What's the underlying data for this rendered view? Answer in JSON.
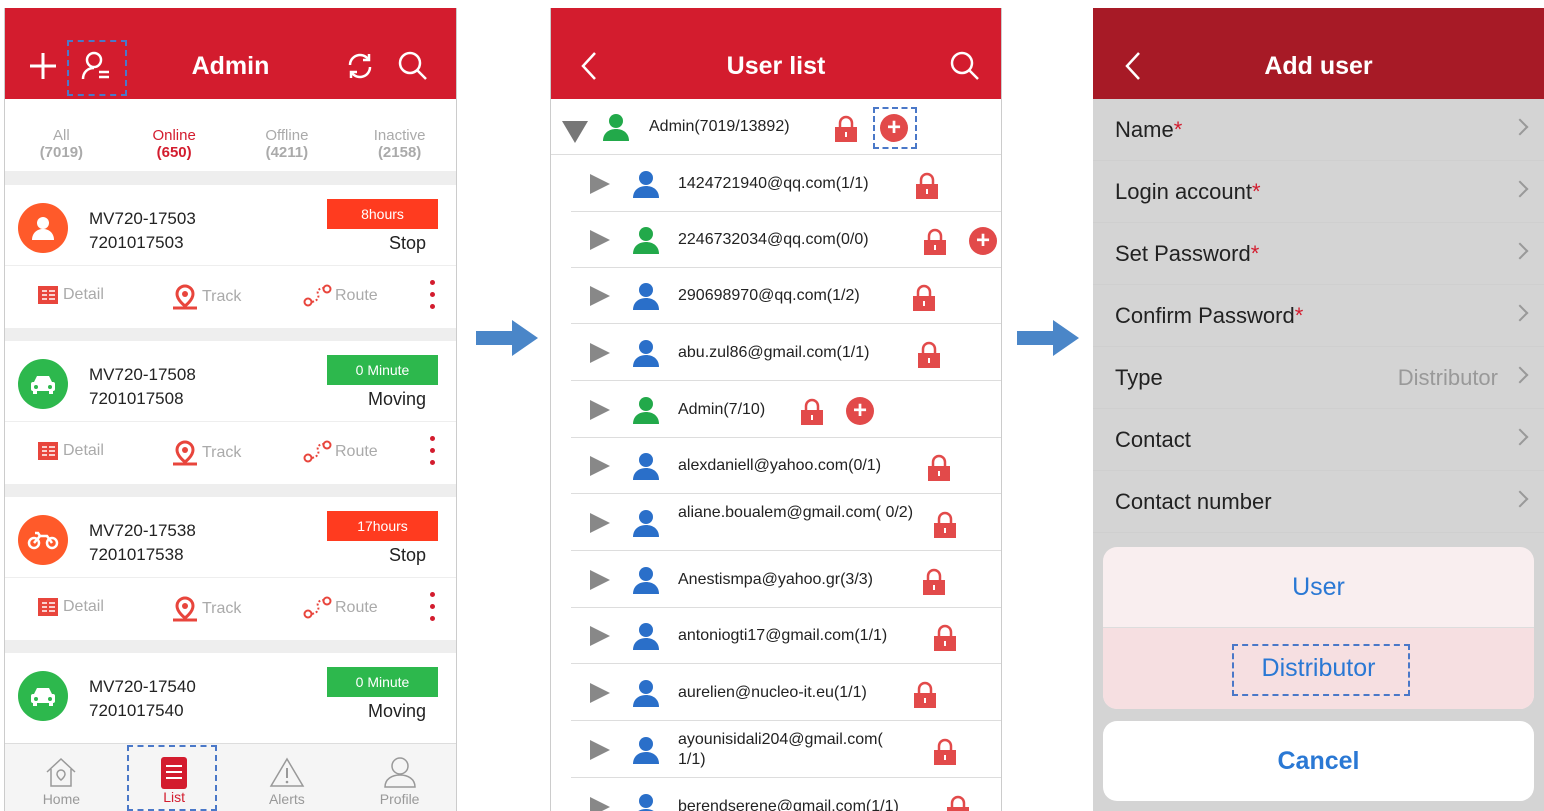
{
  "screen1": {
    "title": "Admin",
    "tabs": [
      {
        "label": "All",
        "count": "(7019)"
      },
      {
        "label": "Online",
        "count": "(650)"
      },
      {
        "label": "Offline",
        "count": "(4211)"
      },
      {
        "label": "Inactive",
        "count": "(2158)"
      }
    ],
    "devices": [
      {
        "name": "MV720-17503",
        "id": "7201017503",
        "badge": "8hours",
        "status": "Stop",
        "badge_color": "#ff3b1f",
        "avatar_color": "#ff5a2a"
      },
      {
        "name": "MV720-17508",
        "id": "7201017508",
        "badge": "0 Minute",
        "status": "Moving",
        "badge_color": "#2db84d",
        "avatar_color": "#2db84d"
      },
      {
        "name": "MV720-17538",
        "id": "7201017538",
        "badge": "17hours",
        "status": "Stop",
        "badge_color": "#ff3b1f",
        "avatar_color": "#ff5a2a"
      },
      {
        "name": "MV720-17540",
        "id": "7201017540",
        "badge": "0 Minute",
        "status": "Moving",
        "badge_color": "#2db84d",
        "avatar_color": "#2db84d"
      }
    ],
    "actions": {
      "detail": "Detail",
      "track": "Track",
      "route": "Route"
    },
    "nav": {
      "home": "Home",
      "list": "List",
      "alerts": "Alerts",
      "profile": "Profile"
    }
  },
  "screen2": {
    "title": "User list",
    "users": [
      {
        "label": "Admin(7019/13892)",
        "color": "green",
        "plus": true
      },
      {
        "label": "1424721940@qq.com(1/1)",
        "color": "blue",
        "plus": false
      },
      {
        "label": "2246732034@qq.com(0/0)",
        "color": "green",
        "plus": true
      },
      {
        "label": "290698970@qq.com(1/2)",
        "color": "blue",
        "plus": false
      },
      {
        "label": "abu.zul86@gmail.com(1/1)",
        "color": "blue",
        "plus": false
      },
      {
        "label": "Admin(7/10)",
        "color": "green",
        "plus": true
      },
      {
        "label": "alexdaniell@yahoo.com(0/1)",
        "color": "blue",
        "plus": false
      },
      {
        "label": "aliane.boualem@gmail.com( 0/2)",
        "color": "blue",
        "plus": false
      },
      {
        "label": "Anestismpa@yahoo.gr(3/3)",
        "color": "blue",
        "plus": false
      },
      {
        "label": "antoniogti17@gmail.com(1/1)",
        "color": "blue",
        "plus": false
      },
      {
        "label": "aurelien@nucleo-it.eu(1/1)",
        "color": "blue",
        "plus": false
      },
      {
        "label": "ayounisidali204@gmail.com( 1/1)",
        "color": "blue",
        "plus": false
      },
      {
        "label": "berendserene@gmail.com(1/1)",
        "color": "blue",
        "plus": false
      }
    ]
  },
  "screen3": {
    "title": "Add user",
    "fields": [
      {
        "label": "Name",
        "required": "*",
        "value": ""
      },
      {
        "label": "Login account",
        "required": "*",
        "value": ""
      },
      {
        "label": "Set Password",
        "required": "*",
        "value": ""
      },
      {
        "label": "Confirm Password",
        "required": "*",
        "value": ""
      },
      {
        "label": "Type",
        "required": "",
        "value": "Distributor"
      },
      {
        "label": "Contact",
        "required": "",
        "value": ""
      },
      {
        "label": "Contact number",
        "required": "",
        "value": ""
      }
    ],
    "sheet": {
      "user": "User",
      "distributor": "Distributor",
      "cancel": "Cancel"
    }
  }
}
